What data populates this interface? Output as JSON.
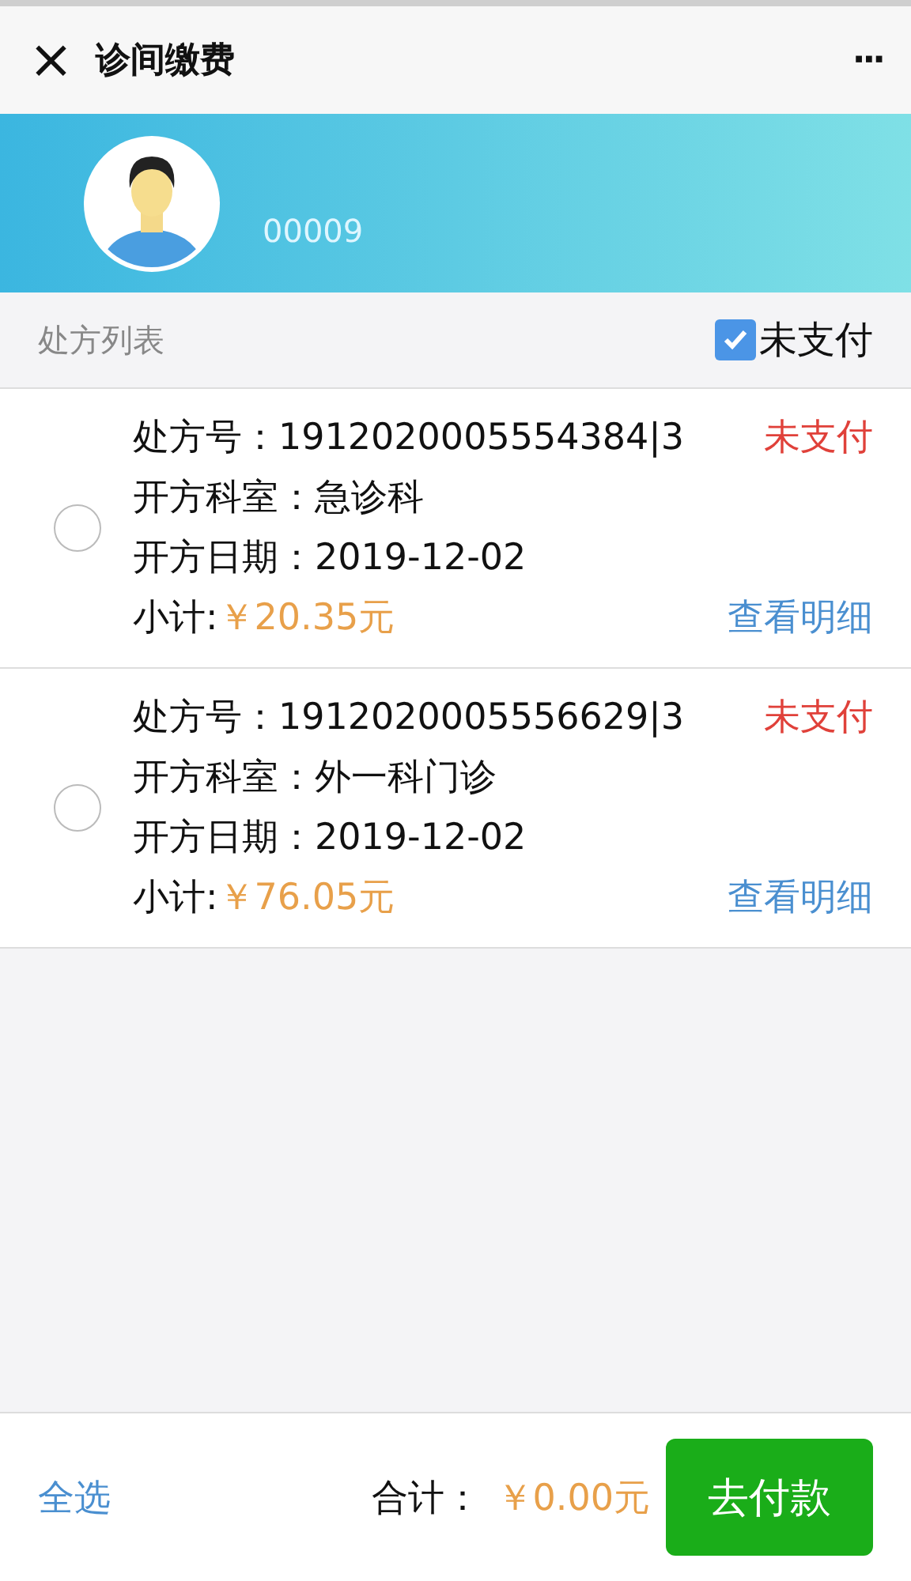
{
  "nav": {
    "close": "×",
    "title": "诊间缴费",
    "more": "···"
  },
  "patient": {
    "id": "00009"
  },
  "list_header": {
    "title": "处方列表",
    "filter": {
      "label": "未支付",
      "checked": true
    }
  },
  "prescriptions": [
    {
      "selected": false,
      "number_label": "处方号：",
      "number": "1912020005554384|3",
      "status": "未支付",
      "dept_label": "开方科室：",
      "dept": "急诊科",
      "date_label": "开方日期：",
      "date": "2019-12-02",
      "subtotal_label": "小计:",
      "subtotal": "￥20.35元",
      "detail_link": "查看明细"
    },
    {
      "selected": false,
      "number_label": "处方号：",
      "number": "1912020005556629|3",
      "status": "未支付",
      "dept_label": "开方科室：",
      "dept": "外一科门诊",
      "date_label": "开方日期：",
      "date": "2019-12-02",
      "subtotal_label": "小计:",
      "subtotal": "￥76.05元",
      "detail_link": "查看明细"
    }
  ],
  "footer": {
    "select_all": "全选",
    "total_label": "合计：",
    "total": "￥0.00元",
    "pay_button": "去付款"
  }
}
